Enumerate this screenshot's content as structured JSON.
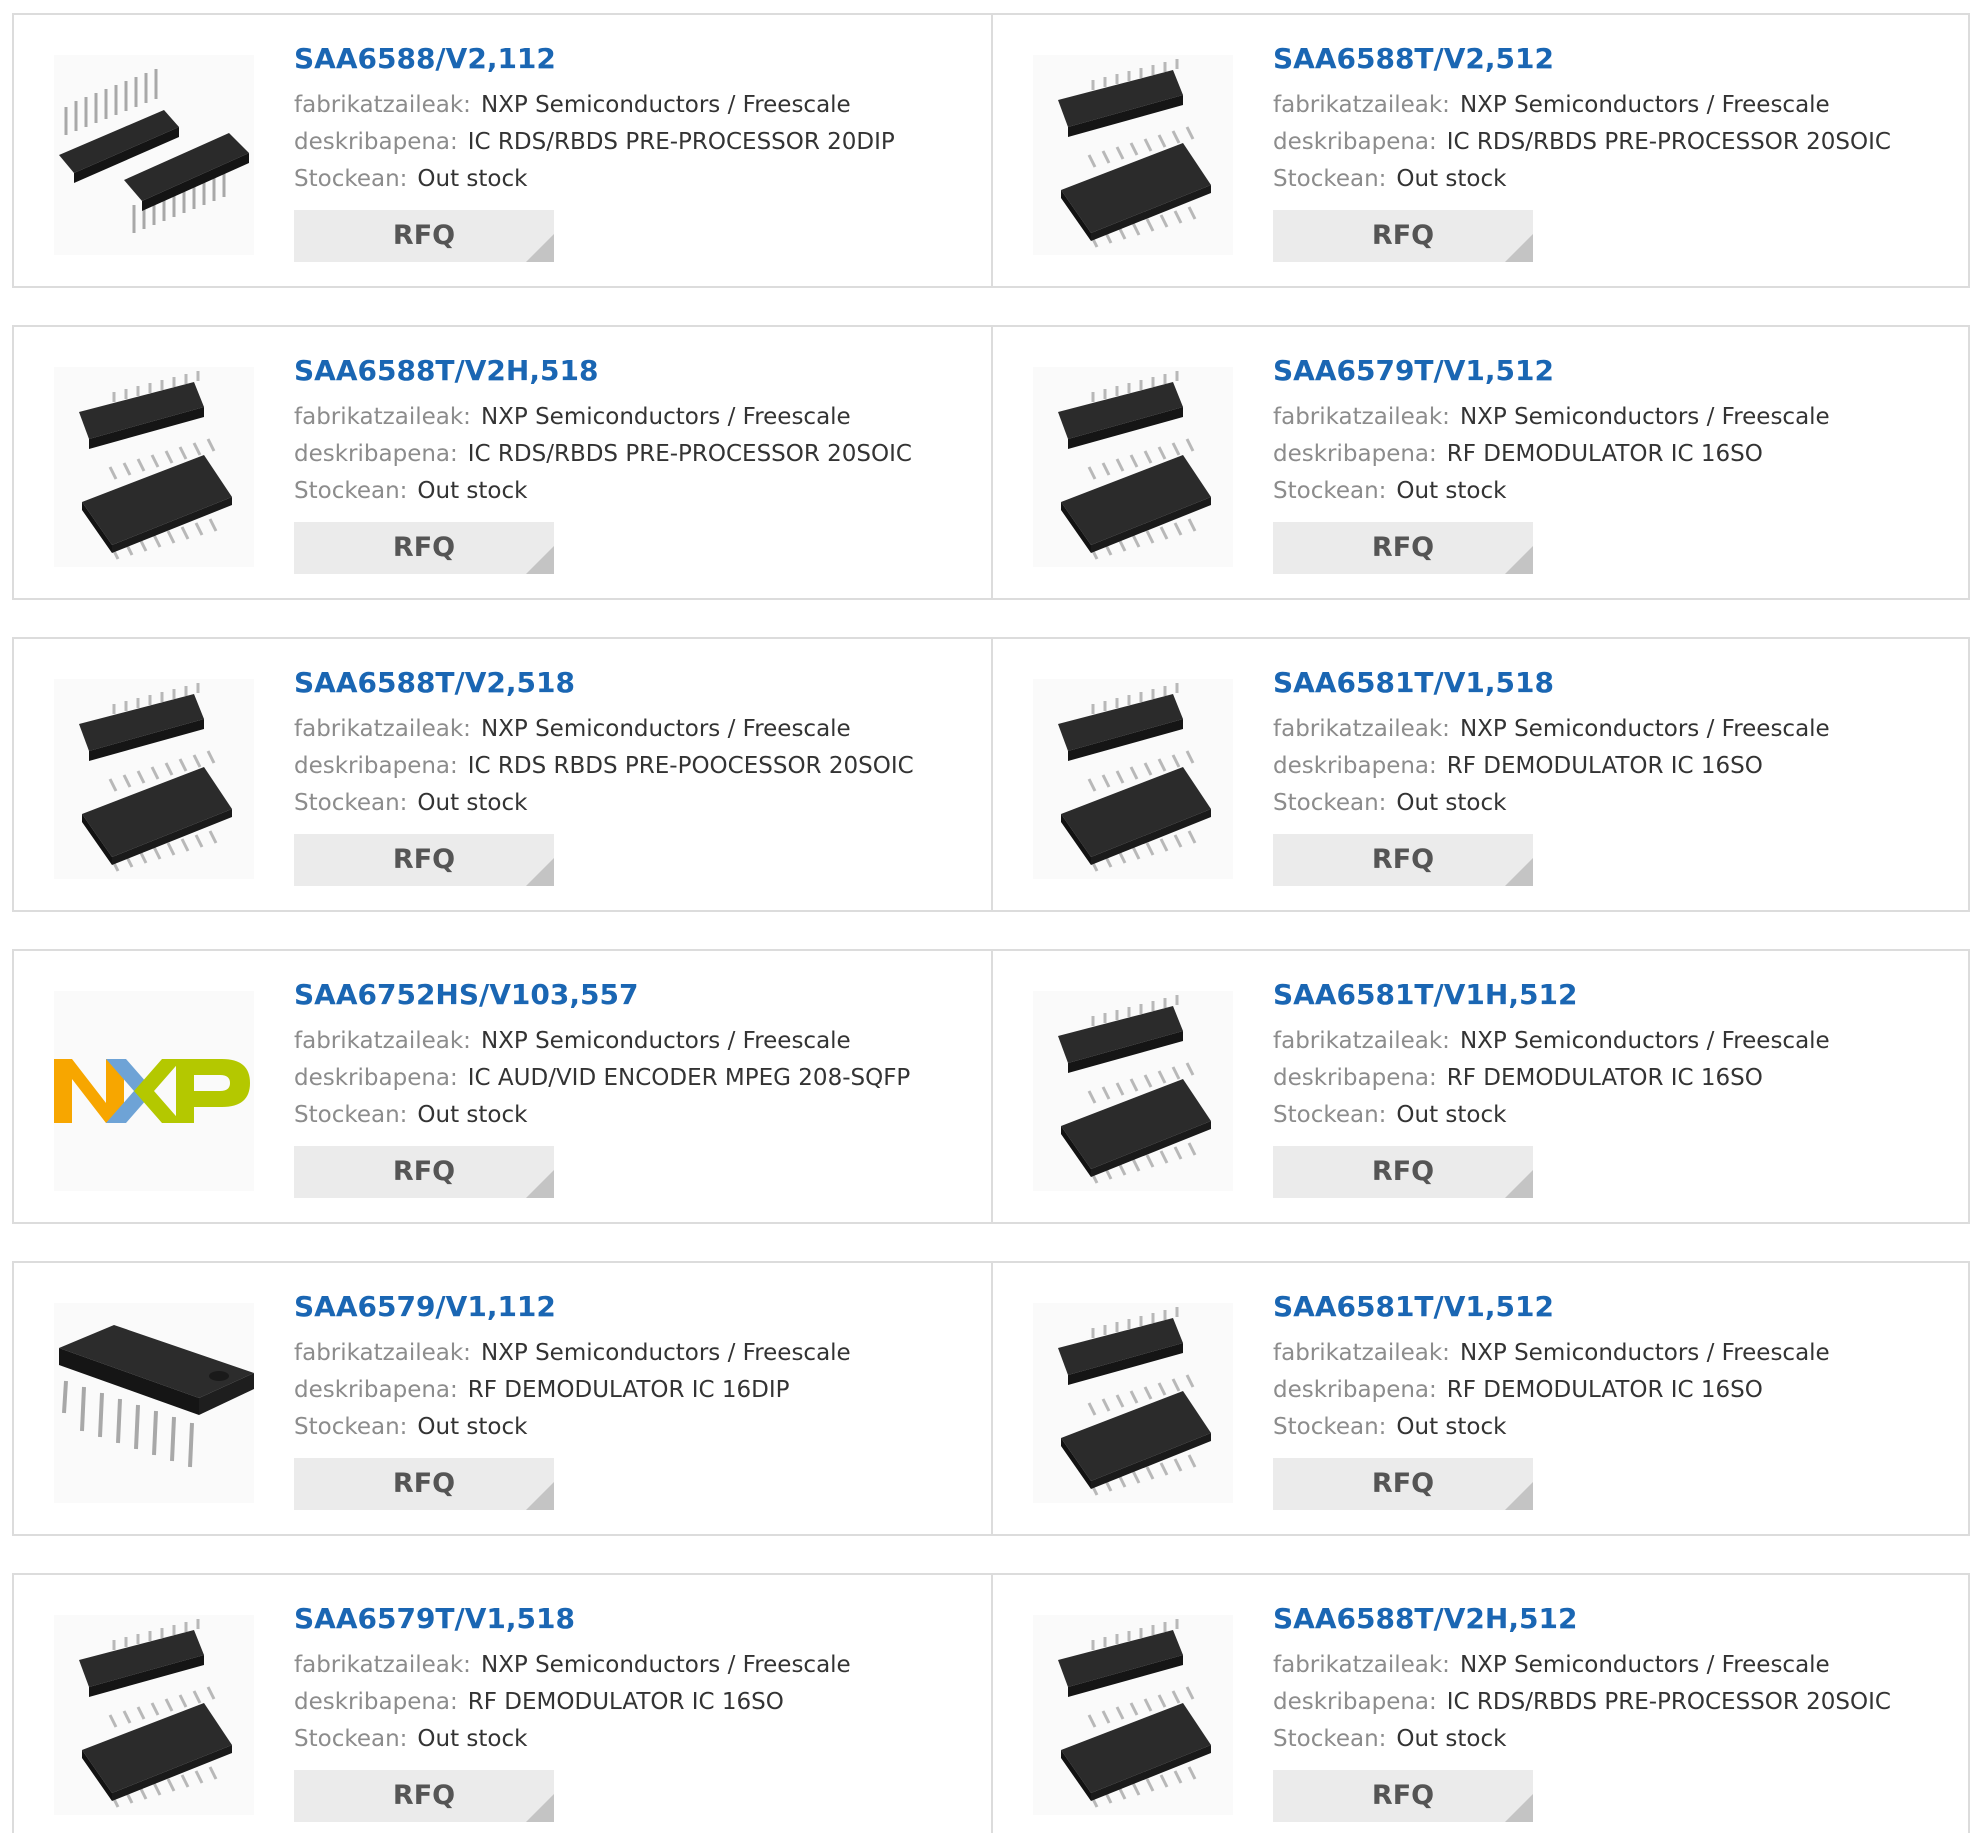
{
  "labels": {
    "manufacturer": "fabrikatzaileak:",
    "description": "deskribapena:",
    "stock": "Stockean:",
    "rfq": "RFQ"
  },
  "colors": {
    "part_link": "#1a66b3",
    "nxp_orange": "#f7a600",
    "nxp_blue": "#6ea3d6",
    "nxp_green": "#b4c800"
  },
  "products": [
    {
      "part": "SAA6588/V2,112",
      "manufacturer": "NXP Semiconductors / Freescale",
      "description": "IC RDS/RBDS PRE-PROCESSOR 20DIP",
      "stock": "Out stock",
      "image": "dip20-chip-image"
    },
    {
      "part": "SAA6588T/V2,512",
      "manufacturer": "NXP Semiconductors / Freescale",
      "description": "IC RDS/RBDS PRE-PROCESSOR 20SOIC",
      "stock": "Out stock",
      "image": "soic-chip-image"
    },
    {
      "part": "SAA6588T/V2H,518",
      "manufacturer": "NXP Semiconductors / Freescale",
      "description": "IC RDS/RBDS PRE-PROCESSOR 20SOIC",
      "stock": "Out stock",
      "image": "soic-chip-image"
    },
    {
      "part": "SAA6579T/V1,512",
      "manufacturer": "NXP Semiconductors / Freescale",
      "description": "RF DEMODULATOR IC 16SO",
      "stock": "Out stock",
      "image": "soic-chip-image"
    },
    {
      "part": "SAA6588T/V2,518",
      "manufacturer": "NXP Semiconductors / Freescale",
      "description": "IC RDS RBDS PRE-POOCESSOR 20SOIC",
      "stock": "Out stock",
      "image": "soic-chip-image"
    },
    {
      "part": "SAA6581T/V1,518",
      "manufacturer": "NXP Semiconductors / Freescale",
      "description": "RF DEMODULATOR IC 16SO",
      "stock": "Out stock",
      "image": "soic-chip-image"
    },
    {
      "part": "SAA6752HS/V103,557",
      "manufacturer": "NXP Semiconductors / Freescale",
      "description": "IC AUD/VID ENCODER MPEG 208-SQFP",
      "stock": "Out stock",
      "image": "nxp-logo"
    },
    {
      "part": "SAA6581T/V1H,512",
      "manufacturer": "NXP Semiconductors / Freescale",
      "description": "RF DEMODULATOR IC 16SO",
      "stock": "Out stock",
      "image": "soic-chip-image"
    },
    {
      "part": "SAA6579/V1,112",
      "manufacturer": "NXP Semiconductors / Freescale",
      "description": "RF DEMODULATOR IC 16DIP",
      "stock": "Out stock",
      "image": "dip16-chip-image"
    },
    {
      "part": "SAA6581T/V1,512",
      "manufacturer": "NXP Semiconductors / Freescale",
      "description": "RF DEMODULATOR IC 16SO",
      "stock": "Out stock",
      "image": "soic-chip-image"
    },
    {
      "part": "SAA6579T/V1,518",
      "manufacturer": "NXP Semiconductors / Freescale",
      "description": "RF DEMODULATOR IC 16SO",
      "stock": "Out stock",
      "image": "soic-chip-image"
    },
    {
      "part": "SAA6588T/V2H,512",
      "manufacturer": "NXP Semiconductors / Freescale",
      "description": "IC RDS/RBDS PRE-PROCESSOR 20SOIC",
      "stock": "Out stock",
      "image": "soic-chip-image"
    }
  ]
}
